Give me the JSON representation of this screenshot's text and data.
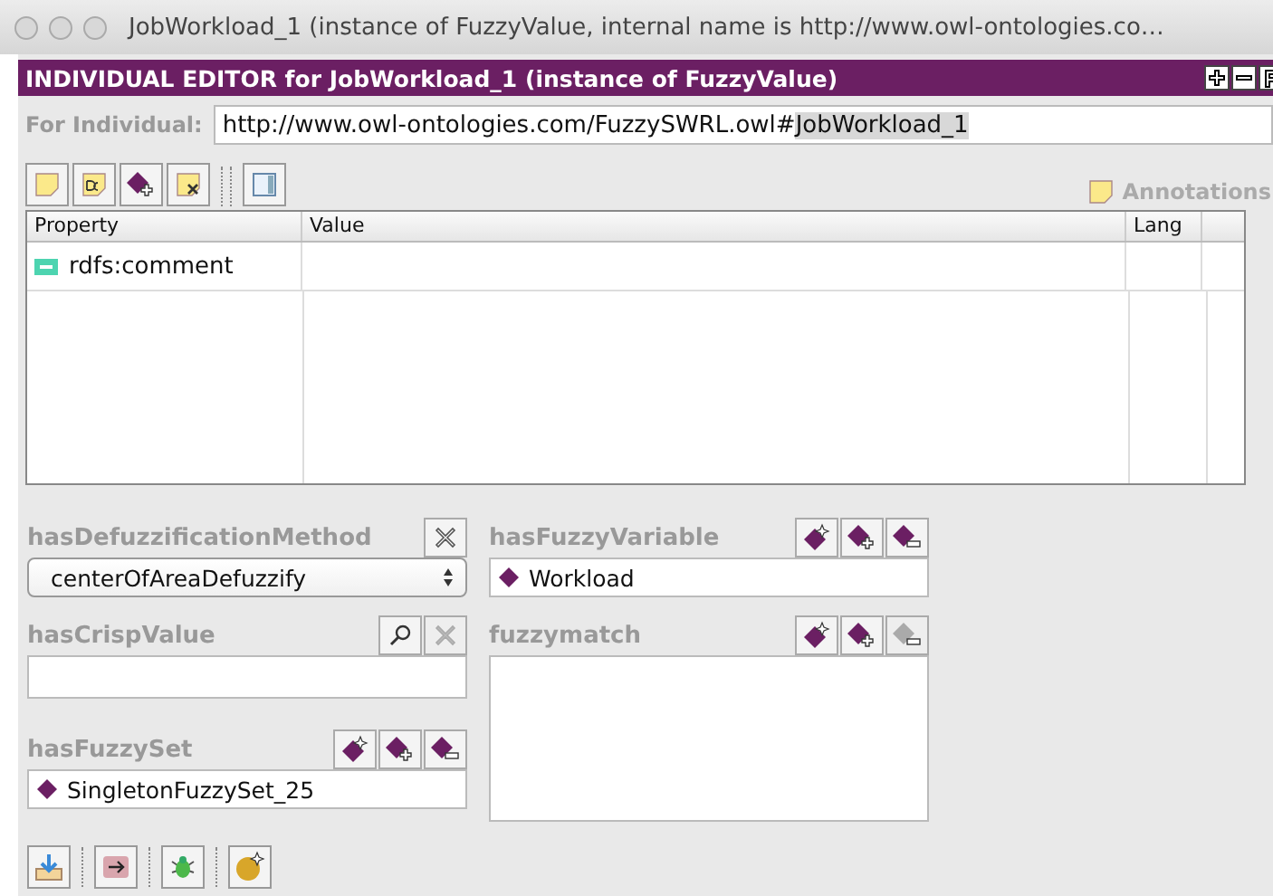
{
  "window": {
    "title": "JobWorkload_1   (instance of FuzzyValue, internal name is http://www.owl-ontologies.co…"
  },
  "editor_header": {
    "title": "INDIVIDUAL EDITOR for JobWorkload_1   (instance of FuzzyValue)"
  },
  "for_individual": {
    "label": "For Individual:",
    "value_prefix": "http://www.owl-ontologies.com/FuzzySWRL.owl#",
    "selection": "JobWorkload_1"
  },
  "annotations_label": "Annotations",
  "table": {
    "columns": [
      "Property",
      "Value",
      "Lang"
    ],
    "rows": [
      {
        "property": "rdfs:comment"
      }
    ]
  },
  "widgets": [
    {
      "label": "hasDefuzzificationMethod",
      "kind": "combo",
      "value": "centerOfAreaDefuzzify",
      "buttons": [
        {
          "kind": "delete",
          "disabled": false
        }
      ]
    },
    {
      "label": "hasFuzzyVariable",
      "kind": "instance",
      "value": "Workload",
      "buttons": [
        {
          "kind": "create",
          "disabled": false
        },
        {
          "kind": "add",
          "disabled": false
        },
        {
          "kind": "remove",
          "disabled": false
        }
      ]
    },
    {
      "label": "hasCrispValue",
      "kind": "text",
      "buttons": [
        {
          "kind": "search",
          "disabled": false
        },
        {
          "kind": "delete",
          "disabled": true
        }
      ]
    },
    {
      "label": "fuzzymatch",
      "kind": "list",
      "buttons": [
        {
          "kind": "create",
          "disabled": false
        },
        {
          "kind": "add",
          "disabled": false
        },
        {
          "kind": "remove",
          "disabled": true
        }
      ]
    },
    {
      "label": "hasFuzzySet",
      "kind": "instance",
      "value": "SingletonFuzzySet_25",
      "buttons": [
        {
          "kind": "create",
          "disabled": false
        },
        {
          "kind": "add",
          "disabled": false
        },
        {
          "kind": "remove",
          "disabled": false
        }
      ]
    }
  ]
}
